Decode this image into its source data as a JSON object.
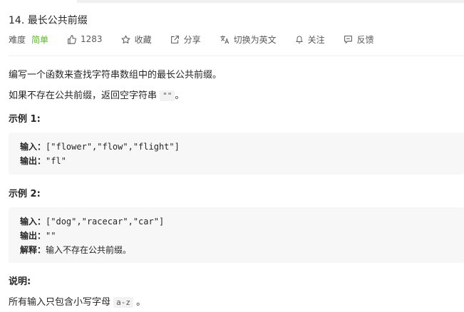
{
  "problem": {
    "title": "14. 最长公共前缀",
    "difficulty_label": "难度",
    "difficulty_value": "简单",
    "likes": "1283",
    "favorite_label": "收藏",
    "share_label": "分享",
    "translate_label": "切换为英文",
    "follow_label": "关注",
    "feedback_label": "反馈"
  },
  "content": {
    "description": "编写一个函数来查找字符串数组中的最长公共前缀。",
    "note_prefix": "如果不存在公共前缀，返回空字符串",
    "note_code": "\"\"",
    "note_suffix": "。",
    "example1_heading": "示例 1:",
    "example1": {
      "input_label": "输入：",
      "input_value": "[\"flower\",\"flow\",\"flight\"]",
      "output_label": "输出：",
      "output_value": "\"fl\""
    },
    "example2_heading": "示例 2:",
    "example2": {
      "input_label": "输入：",
      "input_value": "[\"dog\",\"racecar\",\"car\"]",
      "output_label": "输出：",
      "output_value": "\"\"",
      "explain_label": "解释：",
      "explain_value": "输入不存在公共前缀。"
    },
    "note_heading": "说明:",
    "final_prefix": "所有输入只包含小写字母",
    "final_code": "a-z",
    "final_suffix": "。"
  }
}
